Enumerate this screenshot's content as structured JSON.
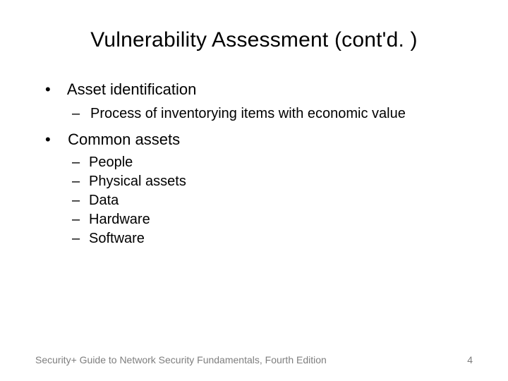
{
  "title": "Vulnerability Assessment (cont'd. )",
  "bullets": {
    "b1": {
      "label": "Asset identification",
      "sub1": "Process of inventorying items with economic value"
    },
    "b2": {
      "label": "Common assets",
      "s1": "People",
      "s2": "Physical assets",
      "s3": "Data",
      "s4": "Hardware",
      "s5": "Software"
    }
  },
  "footer": {
    "source": "Security+ Guide to Network Security Fundamentals, Fourth Edition",
    "page": "4"
  }
}
